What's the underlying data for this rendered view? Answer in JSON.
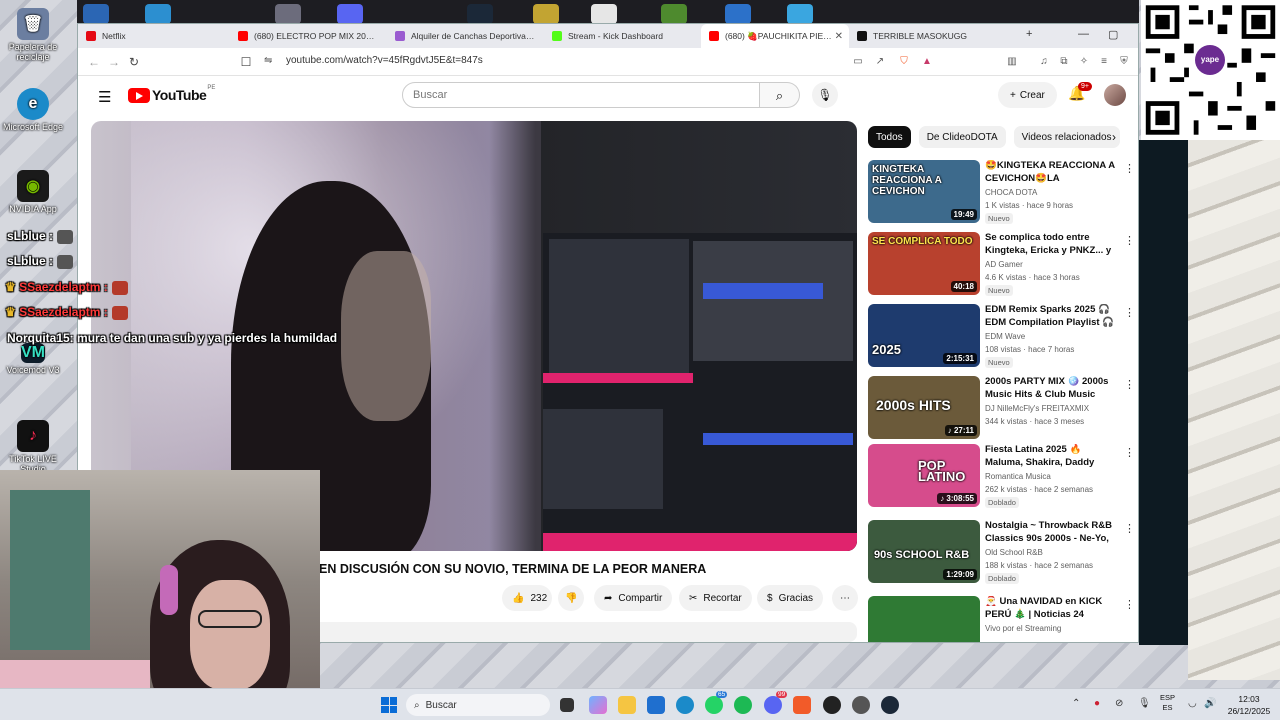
{
  "desktop": {
    "icons": [
      {
        "label": "Papelera de reciclaje",
        "name": "recycle-bin-icon"
      },
      {
        "label": "Microsoft Edge",
        "name": "edge-icon"
      },
      {
        "label": "NVIDIA App",
        "name": "nvidia-icon"
      },
      {
        "label": "Voicemod V3",
        "name": "voicemod-icon"
      },
      {
        "label": "TikTok LIVE Studio",
        "name": "tiktok-icon"
      }
    ]
  },
  "browser": {
    "tabs": [
      {
        "label": "Netflix",
        "color": "#e50914"
      },
      {
        "label": "(680) ELECTRO POP MIX 2000s | D",
        "color": "#ff0000"
      },
      {
        "label": "Alquiler de Canchas Deportivas - P",
        "color": "#9a5bd0"
      },
      {
        "label": "Stream - Kick Dashboard",
        "color": "#53fc18"
      },
      {
        "label": "(680) 🍓PAUCHIKITA PIERDE",
        "color": "#ff0000",
        "active": true
      },
      {
        "label": "TERRIBLE MASOKUGG",
        "color": "#111111"
      }
    ],
    "url": "youtube.com/watch?v=45fRgdvtJ5E&t=847s"
  },
  "youtube": {
    "logo_text": "YouTube",
    "country": "PE",
    "search_placeholder": "Buscar",
    "create_label": "Crear",
    "notification_count": "9+",
    "video_title": "EN DISCUSIÓN CON SU NOVIO, TERMINA DE LA PEOR MANERA",
    "like_count": "232",
    "share_label": "Compartir",
    "clip_label": "Recortar",
    "thanks_label": "Gracias",
    "chips": [
      "Todos",
      "De ClideoDOTA",
      "Videos relacionados"
    ],
    "recommendations": [
      {
        "title": "🤩KINGTEKA REACCIONA A CEVICHON🤩LA DECADENCI...",
        "channel": "CHOCA DOTA",
        "meta": "1 K vistas · hace 9 horas",
        "badge": "Nuevo",
        "duration": "19:49",
        "thumb_text": "KINGTEKA REACCIONA A CEVICHON",
        "thumb_bg": "#3d6a8c"
      },
      {
        "title": "Se complica todo entre Kingteka, Ericka y PNKZ... y ...",
        "channel": "AD Gamer",
        "meta": "4.6 K vistas · hace 3 horas",
        "badge": "Nuevo",
        "duration": "40:18",
        "thumb_text": "SE COMPLICA TODO",
        "thumb_bg": "#b8412e"
      },
      {
        "title": "EDM Remix Sparks 2025 🎧 EDM Compilation Playlist 🎧 ...",
        "channel": "EDM Wave",
        "meta": "108 vistas · hace 7 horas",
        "badge": "Nuevo",
        "duration": "2:15:31",
        "thumb_text": "2025",
        "thumb_bg": "#1e3b6e"
      },
      {
        "title": "2000s PARTY MIX 🪩 2000s Music Hits & Club Music Mixe...",
        "channel": "DJ NilleMcFly's FREITAXMIX",
        "meta": "344 k vistas · hace 3 meses",
        "badge": "",
        "duration": "♪ 27:11",
        "thumb_text": "2000s HITS",
        "thumb_bg": "#6b5a3a"
      },
      {
        "title": "Fiesta Latina 2025 🔥 Maluma, Shakira, Daddy Yankee, Wisin, ...",
        "channel": "Romantica Musica",
        "meta": "262 k vistas · hace 2 semanas",
        "badge": "Doblado",
        "duration": "♪ 3:08:55",
        "thumb_text": "POP LATINO",
        "thumb_bg": "#d64c8c"
      },
      {
        "title": "Nostalgia ~ Throwback R&B Classics 90s 2000s - Ne-Yo, ...",
        "channel": "Old School R&B",
        "meta": "188 k vistas · hace 2 semanas",
        "badge": "Doblado",
        "duration": "1:29:09",
        "thumb_text": "90s SCHOOL R&B",
        "thumb_bg": "#3c5a3e"
      },
      {
        "title": "🎅 Una NAVIDAD en KICK PERÚ 🎄 | Noticias 24 diciembre",
        "channel": "Vivo por el Streaming",
        "meta": "",
        "badge": "",
        "duration": "",
        "thumb_text": "",
        "thumb_bg": "#2f7a34"
      }
    ]
  },
  "chat": [
    {
      "user": "sLblue :",
      "msg": "",
      "red": false
    },
    {
      "user": "sLblue :",
      "msg": "",
      "red": false
    },
    {
      "user": "SSaezdelaptm :",
      "msg": "",
      "red": true
    },
    {
      "user": "SSaezdelaptm :",
      "msg": "",
      "red": true
    },
    {
      "user": "Norquita15:",
      "msg": "mura te dan una sub y ya pierdes la humildad",
      "red": false
    }
  ],
  "qr": {
    "brand": "yape"
  },
  "taskbar": {
    "search_placeholder": "Buscar",
    "badge_a": "65",
    "badge_b": "99",
    "lang_top": "ESP",
    "lang_bottom": "ES",
    "time": "12:03",
    "date": "26/12/2025"
  }
}
